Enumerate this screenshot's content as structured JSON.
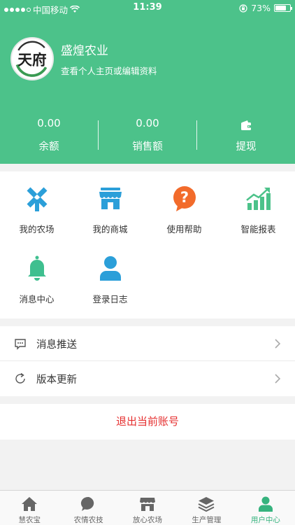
{
  "status_bar": {
    "carrier": "中国移动",
    "time": "11:39",
    "battery": "73%",
    "battery_level": 0.73
  },
  "profile": {
    "avatar_text": "天府",
    "name": "盛煌农业",
    "subtitle": "查看个人主页或编辑资料"
  },
  "stats": [
    {
      "value": "0.00",
      "label": "余额"
    },
    {
      "value": "0.00",
      "label": "销售额"
    },
    {
      "value": "",
      "label": "提现",
      "icon": "wallet-icon"
    }
  ],
  "grid": [
    {
      "label": "我的农场",
      "icon": "windmill-icon",
      "color": "#2b9fd9"
    },
    {
      "label": "我的商城",
      "icon": "store-icon",
      "color": "#2b9fd9"
    },
    {
      "label": "使用帮助",
      "icon": "help-icon",
      "color": "#f26b2b"
    },
    {
      "label": "智能报表",
      "icon": "chart-icon",
      "color": "#4cc28a"
    },
    {
      "label": "消息中心",
      "icon": "bell-icon",
      "color": "#3fbf8f"
    },
    {
      "label": "登录日志",
      "icon": "user-icon",
      "color": "#2b9fd9"
    }
  ],
  "list": [
    {
      "label": "消息推送",
      "icon": "message-icon"
    },
    {
      "label": "版本更新",
      "icon": "refresh-icon"
    }
  ],
  "logout_label": "退出当前账号",
  "tabs": [
    {
      "label": "慧农宝",
      "icon": "home-icon",
      "active": false
    },
    {
      "label": "农情农技",
      "icon": "chat-icon",
      "active": false
    },
    {
      "label": "放心农场",
      "icon": "shop-icon",
      "active": false
    },
    {
      "label": "生产管理",
      "icon": "layers-icon",
      "active": false
    },
    {
      "label": "用户中心",
      "icon": "person-icon",
      "active": true
    }
  ],
  "colors": {
    "brand": "#4cc28a",
    "logout": "#e52e2e",
    "tab_active": "#36b37e"
  }
}
